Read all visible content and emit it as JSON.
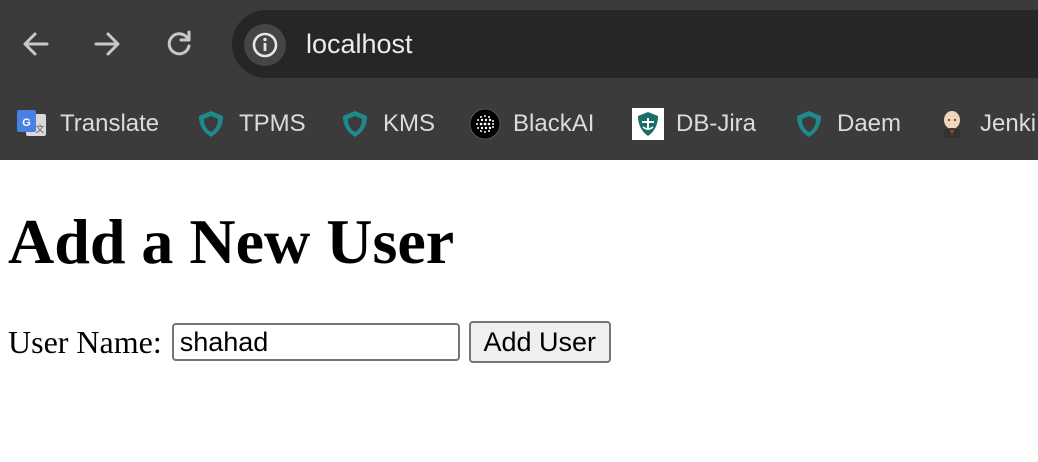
{
  "browser": {
    "url": "localhost",
    "icons": {
      "back": "back-arrow-icon",
      "forward": "forward-arrow-icon",
      "reload": "reload-icon",
      "site_info": "info-icon"
    },
    "bookmarks": [
      {
        "label": "Translate",
        "icon": "google-translate-icon"
      },
      {
        "label": "TPMS",
        "icon": "shield-icon"
      },
      {
        "label": "KMS",
        "icon": "shield-icon"
      },
      {
        "label": "BlackAI",
        "icon": "dotted-sphere-icon"
      },
      {
        "label": "DB-Jira",
        "icon": "emblem-icon"
      },
      {
        "label": "Daem",
        "icon": "shield-icon"
      },
      {
        "label": "Jenki",
        "icon": "jenkins-icon"
      }
    ]
  },
  "page": {
    "title": "Add a New User",
    "form": {
      "label": "User Name:",
      "input_value": "shahad",
      "button_label": "Add User"
    }
  },
  "colors": {
    "browser_frame": "#3b3b3b",
    "omnibox": "#262626",
    "shield_teal": "#1f8a8c"
  }
}
